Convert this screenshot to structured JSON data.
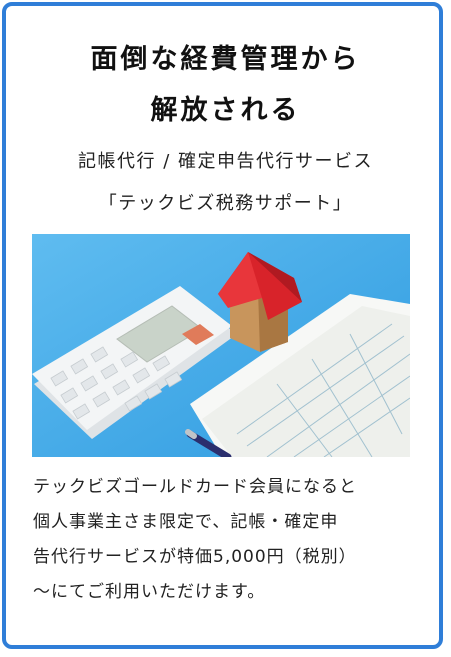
{
  "headline": {
    "line1": "面倒な経費管理から",
    "line2": "解放される"
  },
  "subheading": {
    "line1": "記帳代行 / 確定申告代行サービス",
    "line2": "「テックビズ税務サポート」"
  },
  "photo": {
    "subject": "calculator-house-ledger-photo",
    "colors": {
      "background": "#4aaee8",
      "roof": "#d8232a",
      "calculator": "#eef1f3"
    }
  },
  "description": {
    "lines": [
      "テックビズゴールドカード会員になると",
      "個人事業主さま限定で、記帳・確定申",
      "告代行サービスが特価5,000円（税別）",
      "〜にてご利用いただけます。"
    ]
  },
  "colors": {
    "border": "#2f7ed8",
    "text": "#111111"
  }
}
